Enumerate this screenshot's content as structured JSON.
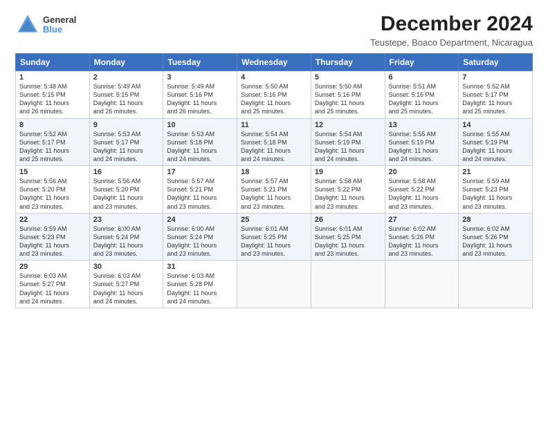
{
  "logo": {
    "line1": "General",
    "line2": "Blue"
  },
  "title": "December 2024",
  "subtitle": "Teustepe, Boaco Department, Nicaragua",
  "headers": [
    "Sunday",
    "Monday",
    "Tuesday",
    "Wednesday",
    "Thursday",
    "Friday",
    "Saturday"
  ],
  "weeks": [
    [
      {
        "day": "1",
        "info": "Sunrise: 5:48 AM\nSunset: 5:15 PM\nDaylight: 11 hours\nand 26 minutes."
      },
      {
        "day": "2",
        "info": "Sunrise: 5:49 AM\nSunset: 5:15 PM\nDaylight: 11 hours\nand 26 minutes."
      },
      {
        "day": "3",
        "info": "Sunrise: 5:49 AM\nSunset: 5:16 PM\nDaylight: 11 hours\nand 26 minutes."
      },
      {
        "day": "4",
        "info": "Sunrise: 5:50 AM\nSunset: 5:16 PM\nDaylight: 11 hours\nand 25 minutes."
      },
      {
        "day": "5",
        "info": "Sunrise: 5:50 AM\nSunset: 5:16 PM\nDaylight: 11 hours\nand 25 minutes."
      },
      {
        "day": "6",
        "info": "Sunrise: 5:51 AM\nSunset: 5:16 PM\nDaylight: 11 hours\nand 25 minutes."
      },
      {
        "day": "7",
        "info": "Sunrise: 5:52 AM\nSunset: 5:17 PM\nDaylight: 11 hours\nand 25 minutes."
      }
    ],
    [
      {
        "day": "8",
        "info": "Sunrise: 5:52 AM\nSunset: 5:17 PM\nDaylight: 11 hours\nand 25 minutes."
      },
      {
        "day": "9",
        "info": "Sunrise: 5:53 AM\nSunset: 5:17 PM\nDaylight: 11 hours\nand 24 minutes."
      },
      {
        "day": "10",
        "info": "Sunrise: 5:53 AM\nSunset: 5:18 PM\nDaylight: 11 hours\nand 24 minutes."
      },
      {
        "day": "11",
        "info": "Sunrise: 5:54 AM\nSunset: 5:18 PM\nDaylight: 11 hours\nand 24 minutes."
      },
      {
        "day": "12",
        "info": "Sunrise: 5:54 AM\nSunset: 5:19 PM\nDaylight: 11 hours\nand 24 minutes."
      },
      {
        "day": "13",
        "info": "Sunrise: 5:55 AM\nSunset: 5:19 PM\nDaylight: 11 hours\nand 24 minutes."
      },
      {
        "day": "14",
        "info": "Sunrise: 5:55 AM\nSunset: 5:19 PM\nDaylight: 11 hours\nand 24 minutes."
      }
    ],
    [
      {
        "day": "15",
        "info": "Sunrise: 5:56 AM\nSunset: 5:20 PM\nDaylight: 11 hours\nand 23 minutes."
      },
      {
        "day": "16",
        "info": "Sunrise: 5:56 AM\nSunset: 5:20 PM\nDaylight: 11 hours\nand 23 minutes."
      },
      {
        "day": "17",
        "info": "Sunrise: 5:57 AM\nSunset: 5:21 PM\nDaylight: 11 hours\nand 23 minutes."
      },
      {
        "day": "18",
        "info": "Sunrise: 5:57 AM\nSunset: 5:21 PM\nDaylight: 11 hours\nand 23 minutes."
      },
      {
        "day": "19",
        "info": "Sunrise: 5:58 AM\nSunset: 5:22 PM\nDaylight: 11 hours\nand 23 minutes."
      },
      {
        "day": "20",
        "info": "Sunrise: 5:58 AM\nSunset: 5:22 PM\nDaylight: 11 hours\nand 23 minutes."
      },
      {
        "day": "21",
        "info": "Sunrise: 5:59 AM\nSunset: 5:23 PM\nDaylight: 11 hours\nand 23 minutes."
      }
    ],
    [
      {
        "day": "22",
        "info": "Sunrise: 5:59 AM\nSunset: 5:23 PM\nDaylight: 11 hours\nand 23 minutes."
      },
      {
        "day": "23",
        "info": "Sunrise: 6:00 AM\nSunset: 5:24 PM\nDaylight: 11 hours\nand 23 minutes."
      },
      {
        "day": "24",
        "info": "Sunrise: 6:00 AM\nSunset: 5:24 PM\nDaylight: 11 hours\nand 23 minutes."
      },
      {
        "day": "25",
        "info": "Sunrise: 6:01 AM\nSunset: 5:25 PM\nDaylight: 11 hours\nand 23 minutes."
      },
      {
        "day": "26",
        "info": "Sunrise: 6:01 AM\nSunset: 5:25 PM\nDaylight: 11 hours\nand 23 minutes."
      },
      {
        "day": "27",
        "info": "Sunrise: 6:02 AM\nSunset: 5:26 PM\nDaylight: 11 hours\nand 23 minutes."
      },
      {
        "day": "28",
        "info": "Sunrise: 6:02 AM\nSunset: 5:26 PM\nDaylight: 11 hours\nand 23 minutes."
      }
    ],
    [
      {
        "day": "29",
        "info": "Sunrise: 6:03 AM\nSunset: 5:27 PM\nDaylight: 11 hours\nand 24 minutes."
      },
      {
        "day": "30",
        "info": "Sunrise: 6:03 AM\nSunset: 5:27 PM\nDaylight: 11 hours\nand 24 minutes."
      },
      {
        "day": "31",
        "info": "Sunrise: 6:03 AM\nSunset: 5:28 PM\nDaylight: 11 hours\nand 24 minutes."
      },
      {
        "day": "",
        "info": ""
      },
      {
        "day": "",
        "info": ""
      },
      {
        "day": "",
        "info": ""
      },
      {
        "day": "",
        "info": ""
      }
    ]
  ]
}
